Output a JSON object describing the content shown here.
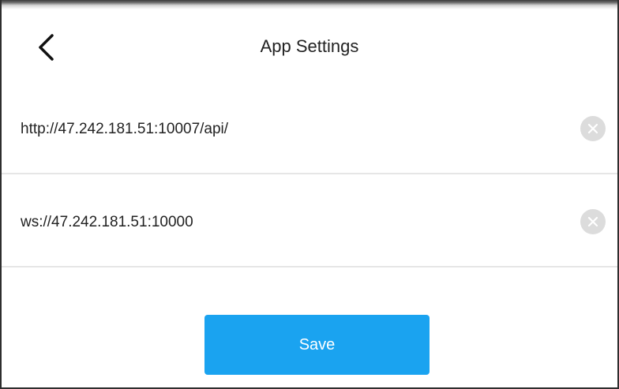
{
  "header": {
    "title": "App Settings",
    "back_icon": "chevron-left-icon"
  },
  "settings": {
    "fields": [
      {
        "value": "http://47.242.181.51:10007/api/",
        "clear_icon": "clear-x-icon"
      },
      {
        "value": "ws://47.242.181.51:10000",
        "clear_icon": "clear-x-icon"
      }
    ]
  },
  "actions": {
    "save_label": "Save"
  },
  "colors": {
    "accent": "#1aa3f0",
    "clear_circle": "#dcdcdc",
    "divider": "#e6e6e6",
    "text": "#222222"
  }
}
